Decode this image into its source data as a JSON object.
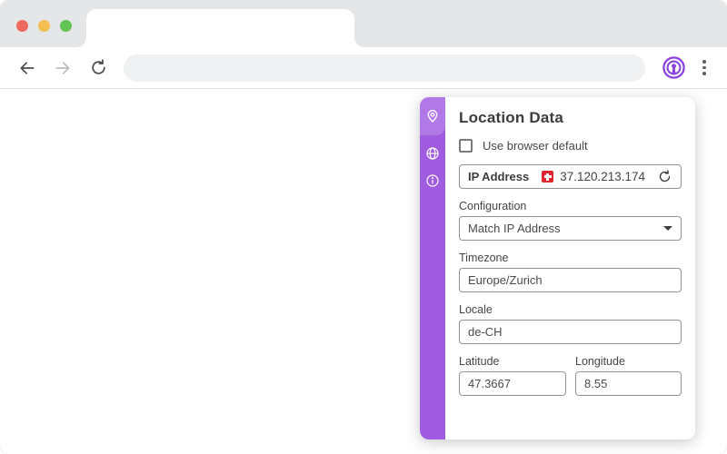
{
  "window_controls": {
    "close_color": "#ee6a5e",
    "minimize_color": "#f5bf4f",
    "maximize_color": "#61c454"
  },
  "browser": {
    "tab_title": "",
    "address_bar_value": ""
  },
  "extension_panel": {
    "title": "Location Data",
    "default_checkbox": {
      "label": "Use browser default",
      "checked": false
    },
    "ip": {
      "label": "IP Address",
      "value": "37.120.213.174",
      "flag_country": "Switzerland"
    },
    "configuration": {
      "label": "Configuration",
      "selected": "Match IP Address"
    },
    "timezone": {
      "label": "Timezone",
      "value": "Europe/Zurich"
    },
    "locale": {
      "label": "Locale",
      "value": "de-CH"
    },
    "latitude": {
      "label": "Latitude",
      "value": "47.3667"
    },
    "longitude": {
      "label": "Longitude",
      "value": "8.55"
    },
    "nav_tabs": [
      "location",
      "globe",
      "info"
    ]
  },
  "colors": {
    "sidebar_purple": "#a05ce0",
    "extension_icon_purple": "#8b44e0",
    "flag_red": "#e0262c"
  }
}
